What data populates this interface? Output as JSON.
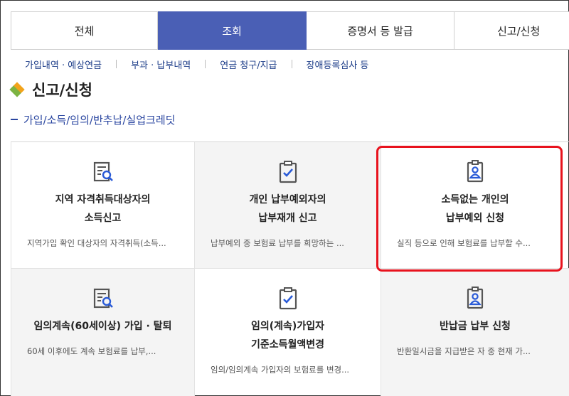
{
  "tabs": [
    {
      "label": "전체",
      "active": false
    },
    {
      "label": "조회",
      "active": true
    },
    {
      "label": "증명서 등 발급",
      "active": false
    },
    {
      "label": "신고/신청",
      "active": false
    }
  ],
  "subnav": [
    "가입내역 · 예상연금",
    "부과 · 납부내역",
    "연금 청구/지급",
    "장애등록심사 등"
  ],
  "section": {
    "title": "신고/신청",
    "icon": "diamond-icon"
  },
  "subhead": "가입/소득/임의/반추납/실업크레딧",
  "cards": [
    {
      "icon": "document-search-icon",
      "title_line1": "지역 자격취득대상자의",
      "title_line2": "소득신고",
      "desc": "지역가입 확인 대상자의 자격취득(소득..."
    },
    {
      "icon": "clipboard-check-icon",
      "title_line1": "개인 납부예외자의",
      "title_line2": "납부재개 신고",
      "desc": "납부예외 중 보험료 납부를 희망하는 ..."
    },
    {
      "icon": "person-badge-icon",
      "title_line1": "소득없는 개인의",
      "title_line2": "납부예외 신청",
      "desc": "실직 등으로 인해 보험료를 납부할 수..."
    },
    {
      "icon": "document-search-icon",
      "title_line1": "임의계속(60세이상) 가입 · 탈퇴",
      "title_line2": "",
      "desc": "60세 이후에도 계속 보험료를 납부,..."
    },
    {
      "icon": "clipboard-check-icon",
      "title_line1": "임의(계속)가입자",
      "title_line2": "기준소득월액변경",
      "desc": "임의/임의계속 가입자의 보험료를 변경..."
    },
    {
      "icon": "person-badge-icon",
      "title_line1": "반납금 납부 신청",
      "title_line2": "",
      "desc": "반환일시금을 지급받은 자 중 현재 가..."
    }
  ],
  "colors": {
    "accent": "#4a5fb5",
    "link": "#1f3f8a",
    "highlight": "#e8121d",
    "card_gray": "#f4f4f4"
  }
}
